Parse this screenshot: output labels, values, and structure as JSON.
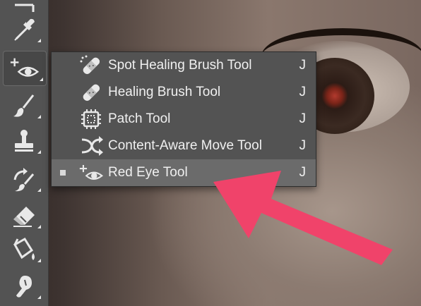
{
  "toolbar": {
    "tools": [
      {
        "name": "crop-tool",
        "icon": "crop-icon"
      },
      {
        "name": "eyedropper-tool",
        "icon": "eyedropper-icon"
      },
      {
        "name": "red-eye-tool",
        "icon": "red-eye-icon",
        "active": true
      },
      {
        "name": "brush-tool",
        "icon": "brush-icon"
      },
      {
        "name": "clone-stamp-tool",
        "icon": "stamp-icon"
      },
      {
        "name": "history-brush-tool",
        "icon": "history-brush-icon"
      },
      {
        "name": "eraser-tool",
        "icon": "eraser-icon"
      },
      {
        "name": "paint-bucket-tool",
        "icon": "paint-bucket-icon"
      },
      {
        "name": "smudge-tool",
        "icon": "smudge-icon"
      }
    ]
  },
  "menu": {
    "items": [
      {
        "label": "Spot Healing Brush Tool",
        "shortcut": "J",
        "icon": "spot-healing-brush-icon",
        "selected": false
      },
      {
        "label": "Healing Brush Tool",
        "shortcut": "J",
        "icon": "healing-brush-icon",
        "selected": false
      },
      {
        "label": "Patch Tool",
        "shortcut": "J",
        "icon": "patch-icon",
        "selected": false
      },
      {
        "label": "Content-Aware Move Tool",
        "shortcut": "J",
        "icon": "content-aware-move-icon",
        "selected": false
      },
      {
        "label": "Red Eye Tool",
        "shortcut": "J",
        "icon": "red-eye-icon",
        "selected": true
      }
    ]
  },
  "colors": {
    "panel": "#535353",
    "highlight": "#6b6b6b",
    "arrow": "#f0436a",
    "text": "#f0f0f0"
  }
}
